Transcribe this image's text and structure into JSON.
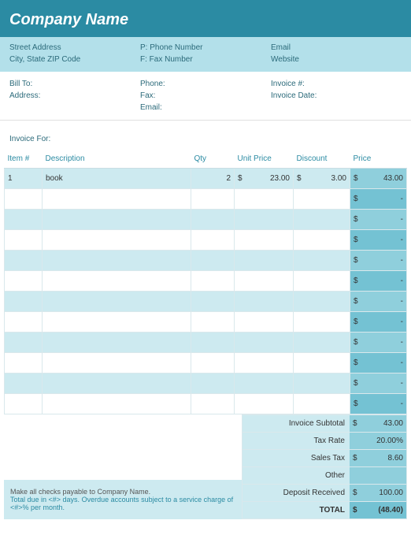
{
  "header": {
    "company": "Company Name"
  },
  "info": {
    "street": "Street Address",
    "city": "City, State ZIP Code",
    "phone": "P: Phone Number",
    "fax": "F: Fax Number",
    "email": "Email",
    "website": "Website"
  },
  "billto": {
    "billto_label": "Bill To:",
    "address_label": "Address:",
    "phone_label": "Phone:",
    "fax_label": "Fax:",
    "email_label": "Email:",
    "invoice_num_label": "Invoice #:",
    "invoice_date_label": "Invoice Date:"
  },
  "invoice_for_label": "Invoice For:",
  "columns": {
    "item": "Item #",
    "description": "Description",
    "qty": "Qty",
    "unit_price": "Unit Price",
    "discount": "Discount",
    "price": "Price"
  },
  "rows": [
    {
      "item": "1",
      "description": "book",
      "qty": "2",
      "unit_price": "23.00",
      "discount": "3.00",
      "price": "43.00"
    },
    {
      "item": "",
      "description": "",
      "qty": "",
      "unit_price": "",
      "discount": "",
      "price": "-"
    },
    {
      "item": "",
      "description": "",
      "qty": "",
      "unit_price": "",
      "discount": "",
      "price": "-"
    },
    {
      "item": "",
      "description": "",
      "qty": "",
      "unit_price": "",
      "discount": "",
      "price": "-"
    },
    {
      "item": "",
      "description": "",
      "qty": "",
      "unit_price": "",
      "discount": "",
      "price": "-"
    },
    {
      "item": "",
      "description": "",
      "qty": "",
      "unit_price": "",
      "discount": "",
      "price": "-"
    },
    {
      "item": "",
      "description": "",
      "qty": "",
      "unit_price": "",
      "discount": "",
      "price": "-"
    },
    {
      "item": "",
      "description": "",
      "qty": "",
      "unit_price": "",
      "discount": "",
      "price": "-"
    },
    {
      "item": "",
      "description": "",
      "qty": "",
      "unit_price": "",
      "discount": "",
      "price": "-"
    },
    {
      "item": "",
      "description": "",
      "qty": "",
      "unit_price": "",
      "discount": "",
      "price": "-"
    },
    {
      "item": "",
      "description": "",
      "qty": "",
      "unit_price": "",
      "discount": "",
      "price": "-"
    },
    {
      "item": "",
      "description": "",
      "qty": "",
      "unit_price": "",
      "discount": "",
      "price": "-"
    }
  ],
  "summary": {
    "subtotal_label": "Invoice Subtotal",
    "subtotal": "43.00",
    "taxrate_label": "Tax Rate",
    "taxrate": "20.00%",
    "salestax_label": "Sales Tax",
    "salestax": "8.60",
    "other_label": "Other",
    "other": "",
    "deposit_label": "Deposit Received",
    "deposit": "100.00",
    "total_label": "TOTAL",
    "total": "(48.40)"
  },
  "footer": {
    "line1": "Make all checks payable to Company Name.",
    "line2": "Total due in <#> days. Overdue accounts subject to a service charge of <#>% per month."
  },
  "currency": "$"
}
